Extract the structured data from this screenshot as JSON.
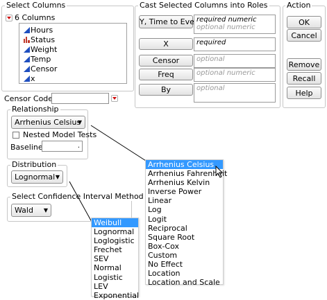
{
  "select_columns": {
    "title": "Select Columns",
    "count_label": "6 Columns",
    "columns": [
      {
        "name": "Hours",
        "icon": "continuous-icon"
      },
      {
        "name": "Status",
        "icon": "nominal-icon"
      },
      {
        "name": "Weight",
        "icon": "continuous-icon"
      },
      {
        "name": "Temp",
        "icon": "continuous-icon"
      },
      {
        "name": "Censor",
        "icon": "continuous-icon"
      },
      {
        "name": "x",
        "icon": "continuous-icon"
      }
    ]
  },
  "cast_roles": {
    "title": "Cast Selected Columns into Roles",
    "roles": [
      {
        "button": "Y, Time to Event",
        "hint": "required numeric",
        "hint2": "optional numeric"
      },
      {
        "button": "X",
        "hint": "required"
      },
      {
        "button": "Censor",
        "hint": "optional"
      },
      {
        "button": "Freq",
        "hint": "optional numeric"
      },
      {
        "button": "By",
        "hint": "optional"
      }
    ]
  },
  "action": {
    "title": "Action",
    "ok": "OK",
    "cancel": "Cancel",
    "remove": "Remove",
    "recall": "Recall",
    "help": "Help"
  },
  "censor_code": {
    "label": "Censor Code:",
    "value": ""
  },
  "relationship": {
    "title": "Relationship",
    "selected": "Arrhenius Celsius",
    "nested_label": "Nested Model Tests",
    "nested_checked": false,
    "baseline_label": "Baseline",
    "baseline_value": "."
  },
  "distribution": {
    "title": "Distribution",
    "selected": "Lognormal"
  },
  "confidence": {
    "title": "Select Confidence Interval Method",
    "selected": "Wald"
  },
  "relationship_menu": {
    "options": [
      "Arrhenius Celsius",
      "Arrhenius Fahrenheit",
      "Arrhenius Kelvin",
      "Inverse Power",
      "Linear",
      "Log",
      "Logit",
      "Reciprocal",
      "Square Root",
      "Box-Cox",
      "Custom",
      "No Effect",
      "Location",
      "Location and Scale"
    ],
    "highlighted": "Arrhenius Celsius"
  },
  "distribution_menu": {
    "options": [
      "Weibull",
      "Lognormal",
      "Loglogistic",
      "Frechet",
      "SEV",
      "Normal",
      "Logistic",
      "LEV",
      "Exponential"
    ],
    "highlighted": "Weibull"
  },
  "colors": {
    "highlight": "#3399ff",
    "red_triangle": "#d01010",
    "continuous_icon": "#1f4fbf",
    "nominal_icon": "#c0392b"
  }
}
